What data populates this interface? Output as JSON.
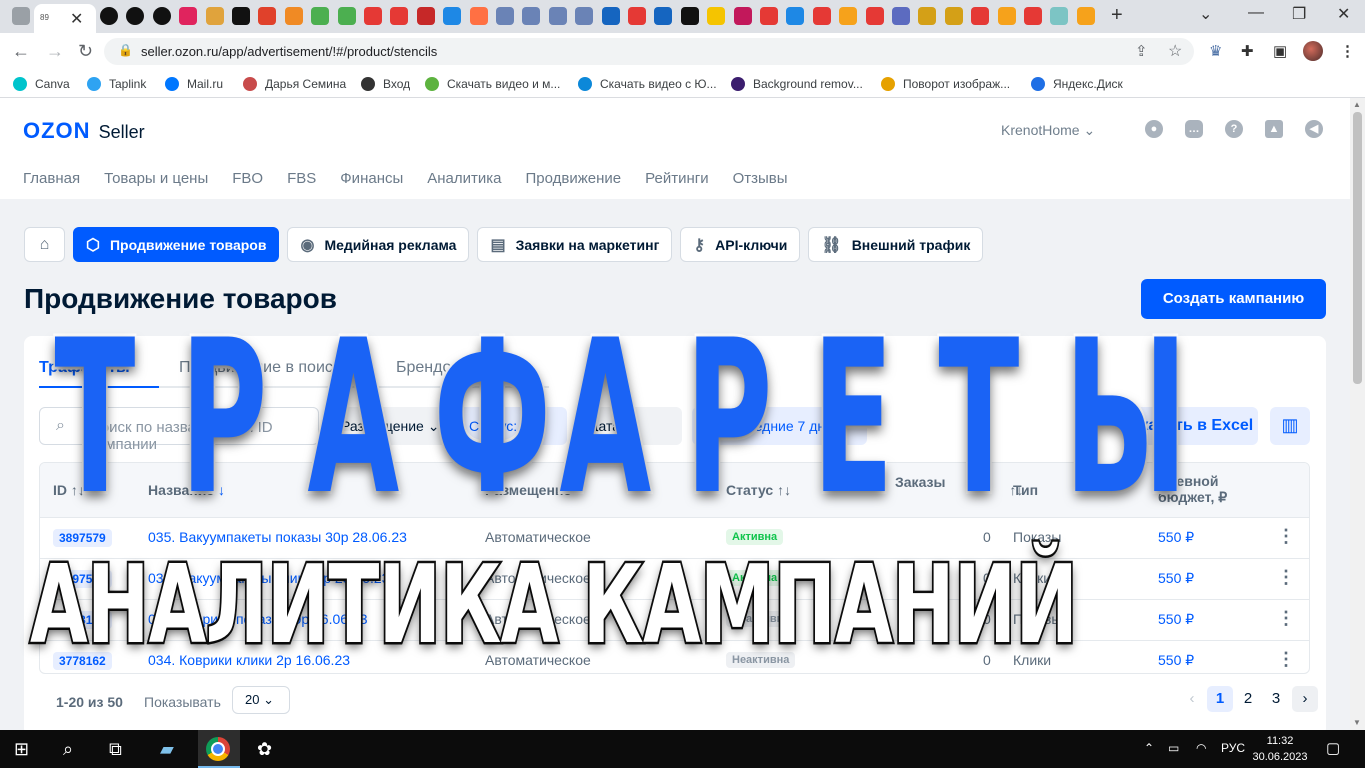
{
  "browser": {
    "active_tab_number": "89",
    "url": "seller.ozon.ru/app/advertisement/!#/product/stencils",
    "bookmarks": [
      "Canva",
      "Taplink",
      "Mail.ru",
      "Дарья Семина",
      "Вход",
      "Скачать видео и м...",
      "Скачать видео с Ю...",
      "Background remov...",
      "Поворот изображ...",
      "Яндекс.Диск"
    ],
    "bookmark_colors": [
      "#00c4cc",
      "#2ea3f2",
      "#0077ff",
      "#c84b4b",
      "#333333",
      "#5db33f",
      "#0c88d9",
      "#3b1d6e",
      "#e6a100",
      "#1f6fe5"
    ]
  },
  "header": {
    "logo": "OZON",
    "logo_suffix": "Seller",
    "account": "KrenotHome",
    "nav": [
      "Главная",
      "Товары и цены",
      "FBO",
      "FBS",
      "Финансы",
      "Аналитика",
      "Продвижение",
      "Рейтинги",
      "Отзывы"
    ]
  },
  "subtabs": [
    "Продвижение товаров",
    "Медийная реклама",
    "Заявки на маркетинг",
    "API-ключи",
    "Внешний трафик"
  ],
  "page_title": "Продвижение товаров",
  "create_button": "Создать кампанию",
  "panel": {
    "tabs": [
      "Трафареты",
      "Продвижение в поиске",
      "Брендовая полка"
    ],
    "search_placeholder": "Поиск по названию или ID кампании",
    "filters": [
      "Размещение",
      "Статус: 2",
      "Дата",
      "За последние 7 дней"
    ],
    "excel_button": "Скачать в Excel"
  },
  "table": {
    "headers": [
      "ID",
      "Название",
      "Размещение",
      "Статус",
      "Заказы",
      "Тип",
      "Дневной бюджет, ₽"
    ],
    "rows": [
      {
        "id": "3897579",
        "name": "035. Вакуумпакеты показы 30р 28.06.23",
        "placement": "Автоматическое",
        "status": "Активна",
        "status_active": true,
        "orders": "0",
        "type": "Показы",
        "budget": "550 ₽"
      },
      {
        "id": "3897577",
        "name": "035. Вакуумпакеты клики 2р 28.06.23",
        "placement": "Автоматическое",
        "status": "Активна",
        "status_active": true,
        "orders": "0",
        "type": "Клики",
        "budget": "550 ₽"
      },
      {
        "id": "3778163",
        "name": "034. Коврики показы 30р 16.06.23",
        "placement": "Автоматическое",
        "status": "Неактивна",
        "status_active": false,
        "orders": "0",
        "type": "Показы",
        "budget": "550 ₽"
      },
      {
        "id": "3778162",
        "name": "034. Коврики клики 2р 16.06.23",
        "placement": "Автоматическое",
        "status": "Неактивна",
        "status_active": false,
        "orders": "0",
        "type": "Клики",
        "budget": "550 ₽"
      }
    ]
  },
  "pagination": {
    "info": "1-20 из 50",
    "show_label": "Показывать",
    "page_size": "20",
    "pages": [
      "1",
      "2",
      "3"
    ]
  },
  "overlay": {
    "title": "ТРАФАРЕТЫ",
    "subtitle": "АНАЛИТИКА КАМПАНИЙ"
  },
  "taskbar": {
    "time": "11:32",
    "date": "30.06.2023",
    "lang": "РУС"
  }
}
